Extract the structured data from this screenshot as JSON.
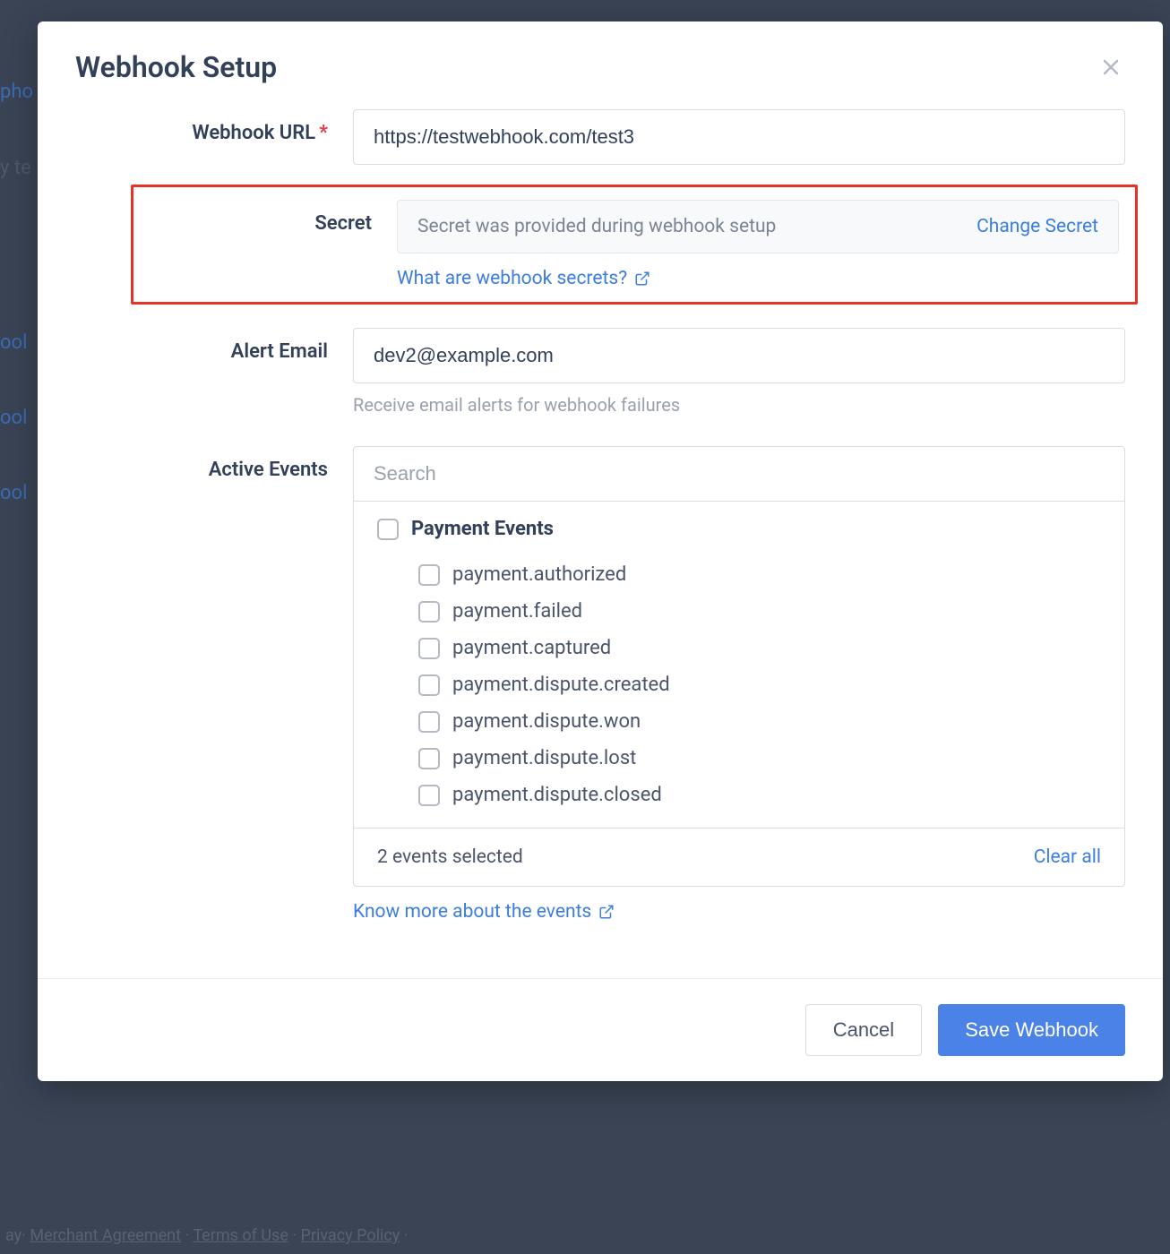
{
  "modal": {
    "title": "Webhook Setup",
    "labels": {
      "webhook_url": "Webhook URL",
      "secret": "Secret",
      "alert_email": "Alert Email",
      "active_events": "Active Events"
    },
    "webhook_url": {
      "value": "https://testwebhook.com/test3"
    },
    "secret": {
      "placeholder_text": "Secret was provided during webhook setup",
      "change_link": "Change Secret",
      "help_link": "What are webhook secrets?"
    },
    "alert_email": {
      "value": "dev2@example.com",
      "hint": "Receive email alerts for webhook failures"
    },
    "events": {
      "search_placeholder": "Search",
      "group_title": "Payment Events",
      "items": [
        "payment.authorized",
        "payment.failed",
        "payment.captured",
        "payment.dispute.created",
        "payment.dispute.won",
        "payment.dispute.lost",
        "payment.dispute.closed"
      ],
      "selected_count_text": "2 events selected",
      "clear_all": "Clear all",
      "know_more": "Know more about the events"
    },
    "buttons": {
      "cancel": "Cancel",
      "save": "Save Webhook"
    }
  },
  "background": {
    "legal": {
      "prefix": "ay·",
      "merchant": "Merchant Agreement",
      "sep": " · ",
      "terms": "Terms of Use",
      "privacy": "Privacy Policy"
    }
  }
}
